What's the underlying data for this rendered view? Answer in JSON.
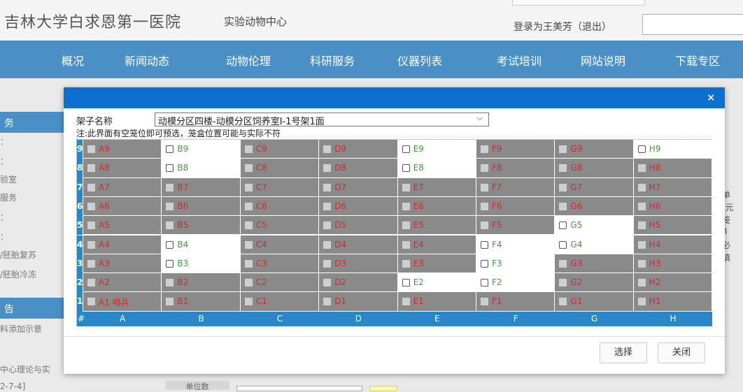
{
  "header": {
    "logo": "吉林大学白求恩第一医院",
    "center": "实验动物中心",
    "login": "登录为王美芳（退出）"
  },
  "nav": [
    "概况",
    "新闻动态",
    "动物伦理",
    "科研服务",
    "仪器列表",
    "考试培训",
    "网站说明",
    "下载专区"
  ],
  "sidebar": {
    "heading": "务",
    "items": [
      "：",
      "：",
      "验室",
      "服务",
      "：",
      "：",
      "/胚胎复苏",
      "/胚胎冷冻"
    ],
    "heading2": "告",
    "items2": [
      "料添加示意",
      "中心理论与实",
      "2-7-4]"
    ]
  },
  "right_fragments": [
    "单",
    "(元",
    "笼",
    "3",
    "必",
    "填"
  ],
  "bottom": {
    "label": "单位数"
  },
  "modal": {
    "close_icon": "×",
    "rack_label": "架子名称",
    "rack_value": "动模分区四楼-动模分区饲养室Ⅰ-1号架1面",
    "note": "注:此界面有空笼位即可预选，笼盒位置可能与实际不符",
    "columns": [
      "A",
      "B",
      "C",
      "D",
      "E",
      "F",
      "G",
      "H"
    ],
    "rows": [
      "9",
      "8",
      "7",
      "6",
      "5",
      "4",
      "3",
      "2",
      "1"
    ],
    "axis_corner": "#",
    "cells": [
      [
        "A9",
        "B9",
        "C9",
        "D9",
        "E9",
        "F9",
        "G9",
        "H9"
      ],
      [
        "A8",
        "B8",
        "C8",
        "D8",
        "E8",
        "F8",
        "G8",
        "H8"
      ],
      [
        "A7",
        "B7",
        "C7",
        "D7",
        "E7",
        "F7",
        "G7",
        "H7"
      ],
      [
        "A6",
        "B6",
        "C6",
        "D6",
        "E6",
        "F6",
        "G6",
        "H6"
      ],
      [
        "A5",
        "B5",
        "C5",
        "D5",
        "E5",
        "F5",
        "G5",
        "H5"
      ],
      [
        "A4",
        "B4",
        "C4",
        "D4",
        "E4",
        "F4",
        "G4",
        "H4"
      ],
      [
        "A3",
        "B3",
        "C3",
        "D3",
        "E3",
        "F3",
        "G3",
        "H3"
      ],
      [
        "A2",
        "B2",
        "C2",
        "D2",
        "E2",
        "F2",
        "G2",
        "H2"
      ],
      [
        "A1 哨兵",
        "B1",
        "C1",
        "D1",
        "E1",
        "F1",
        "G1",
        "H1"
      ]
    ],
    "free": [
      [
        0,
        1
      ],
      [
        0,
        4
      ],
      [
        0,
        7
      ],
      [
        1,
        1
      ],
      [
        1,
        4
      ],
      [
        4,
        6
      ],
      [
        5,
        1
      ],
      [
        5,
        5
      ],
      [
        5,
        6
      ],
      [
        6,
        1
      ],
      [
        6,
        5
      ],
      [
        7,
        4
      ],
      [
        7,
        5
      ]
    ],
    "select_btn": "选择",
    "close_btn": "关闭"
  },
  "colors": {
    "nav": "#4a90c6",
    "modal_bar": "#0d6fcf",
    "occupied": "#8a8a8a",
    "occupied_text": "#d12a2a",
    "free_text": "#3aa533",
    "row_header": "#2a86c8"
  }
}
